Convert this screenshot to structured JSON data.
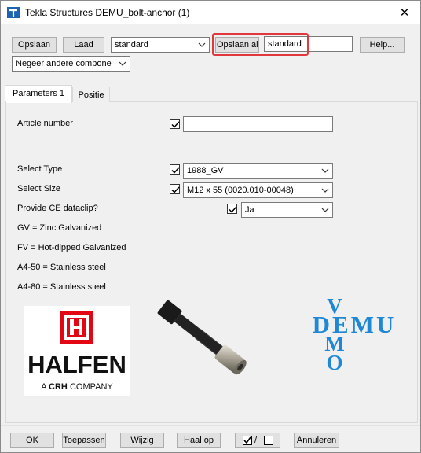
{
  "window": {
    "title": "Tekla Structures  DEMU_bolt-anchor (1)",
    "close_glyph": "✕"
  },
  "toolbar": {
    "save_label": "Opslaan",
    "load_label": "Laad",
    "load_select_value": "standard",
    "save_as_label": "Opslaan al",
    "save_as_value": "standard",
    "help_label": "Help...",
    "filter_value": "Negeer andere compone"
  },
  "tabs": [
    {
      "label": "Parameters 1"
    },
    {
      "label": "Positie"
    }
  ],
  "fields": {
    "article_number_label": "Article number",
    "article_number_value": "",
    "select_type_label": "Select Type",
    "select_type_value": "1988_GV",
    "select_size_label": "Select Size",
    "select_size_value": "M12 x 55  (0020.010-00048)",
    "provide_ce_label": "Provide CE dataclip?",
    "provide_ce_value": "Ja"
  },
  "notes": [
    "GV = Zinc Galvanized",
    "FV = Hot-dipped Galvanized",
    "A4-50 = Stainless steel",
    "A4-80 = Stainless steel"
  ],
  "logos": {
    "halfen_name": "HALFEN",
    "halfen_tagline_a": "A ",
    "halfen_tagline_b": "CRH",
    "halfen_tagline_c": " COMPANY",
    "demu_word_horizontal": "DEMU",
    "demu_word_vertical": [
      "V",
      "E",
      "M",
      "O"
    ]
  },
  "footer": {
    "ok_label": "OK",
    "apply_label": "Toepassen",
    "modify_label": "Wijzig",
    "get_label": "Haal op",
    "toggle_label": "/",
    "cancel_label": "Annuleren"
  },
  "colors": {
    "highlight": "#e0383e",
    "halfen_red": "#e30613",
    "demu_blue": "#1e88d6"
  }
}
